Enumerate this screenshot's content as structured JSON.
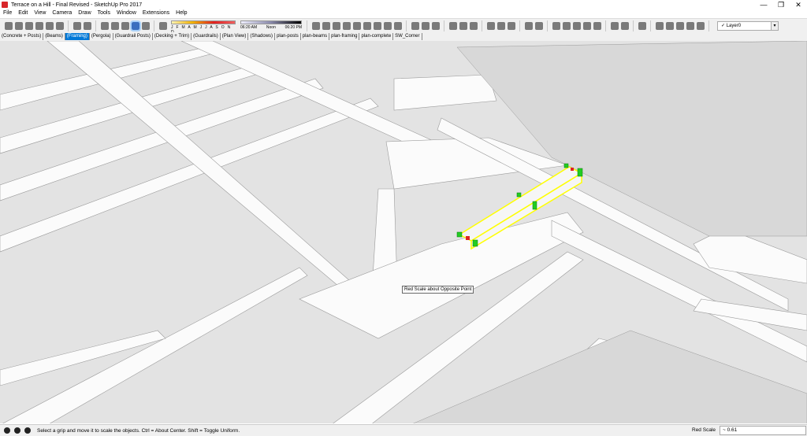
{
  "window": {
    "title": "Terrace on a Hill - Final Revised - SketchUp Pro 2017",
    "minimize": "—",
    "maximize": "❐",
    "close": "✕"
  },
  "menu": [
    "File",
    "Edit",
    "View",
    "Camera",
    "Draw",
    "Tools",
    "Window",
    "Extensions",
    "Help"
  ],
  "toolbar": {
    "shadow_months": "J F M A M J J A S O N D",
    "time_start": "06:20 AM",
    "time_noon": "Noon",
    "time_end": "06:20 PM",
    "layer": {
      "check": "✓",
      "value": "Layer0",
      "dropdown": "▾"
    }
  },
  "scene_tabs": [
    {
      "label": "(Concrete + Posts)",
      "active": false
    },
    {
      "label": "(Beams)",
      "active": false
    },
    {
      "label": "(Framing)",
      "active": true
    },
    {
      "label": "(Pergola)",
      "active": false
    },
    {
      "label": "(Guardrail Posts)",
      "active": false
    },
    {
      "label": "(Decking + Trim)",
      "active": false
    },
    {
      "label": "(Guardrails)",
      "active": false
    },
    {
      "label": "(Plan View)",
      "active": false
    },
    {
      "label": "(Shadows)",
      "active": false
    },
    {
      "label": "plan-posts",
      "active": false
    },
    {
      "label": "plan-beams",
      "active": false
    },
    {
      "label": "plan-framing",
      "active": false
    },
    {
      "label": "plan-complete",
      "active": false
    },
    {
      "label": "SW_Corner",
      "active": false
    }
  ],
  "viewport": {
    "tooltip": "Red Scale about Opposite Point",
    "selection_color": "#ffff00",
    "grip_color": "#22cc22"
  },
  "status": {
    "message": "Select a grip and move it to scale the objects. Ctrl = About Center. Shift = Toggle Uniform.",
    "vcb_label": "Red Scale",
    "vcb_value": "~ 0.61"
  },
  "colors": {
    "active_tab": "#0078d7",
    "logo": "#d8262a"
  }
}
